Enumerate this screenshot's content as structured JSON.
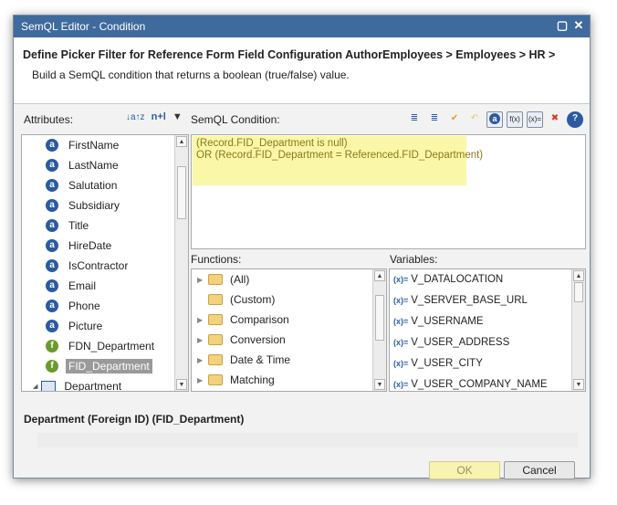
{
  "titlebar": {
    "title": "SemQL Editor - Condition",
    "maximize_icon": "maximize-icon",
    "close_icon": "close-icon"
  },
  "header": {
    "heading": "Define Picker Filter for Reference Form Field Configuration AuthorEmployees > Employees > HR >",
    "subheading": "Build a SemQL condition that returns a boolean (true/false) value."
  },
  "attributes": {
    "label": "Attributes:",
    "sort_label": "n+l",
    "items": [
      {
        "label": "FirstName",
        "icon": "a"
      },
      {
        "label": "LastName",
        "icon": "a"
      },
      {
        "label": "Salutation",
        "icon": "a"
      },
      {
        "label": "Subsidiary",
        "icon": "a"
      },
      {
        "label": "Title",
        "icon": "a"
      },
      {
        "label": "HireDate",
        "icon": "a"
      },
      {
        "label": "IsContractor",
        "icon": "a"
      },
      {
        "label": "Email",
        "icon": "a"
      },
      {
        "label": "Phone",
        "icon": "a"
      },
      {
        "label": "Picture",
        "icon": "a"
      },
      {
        "label": "FDN_Department",
        "icon": "f"
      },
      {
        "label": "FID_Department",
        "icon": "f"
      },
      {
        "label": "Department",
        "icon": "reference"
      }
    ]
  },
  "condition": {
    "label": "SemQL Condition:",
    "lines": [
      "(Record.FID_Department is null)",
      "OR (Record.FID_Department = Referenced.FID_Department)"
    ]
  },
  "functions": {
    "label": "Functions:",
    "items": [
      "(All)",
      "(Custom)",
      "Comparison",
      "Conversion",
      "Date & Time",
      "Matching"
    ]
  },
  "variables": {
    "label": "Variables:",
    "items": [
      "V_DATALOCATION",
      "V_SERVER_BASE_URL",
      "V_USERNAME",
      "V_USER_ADDRESS",
      "V_USER_CITY",
      "V_USER_COMPANY_NAME"
    ]
  },
  "status": {
    "text": "Department (Foreign ID) (FID_Department)"
  },
  "buttons": {
    "ok": "OK",
    "cancel": "Cancel"
  },
  "toolbar_labels": {
    "fx": "f(x)",
    "var": "(x)="
  },
  "colors": {
    "titlebar": "#3f6a9e",
    "highlight": "#fbf7a8",
    "selected": "#9a9a9a"
  }
}
